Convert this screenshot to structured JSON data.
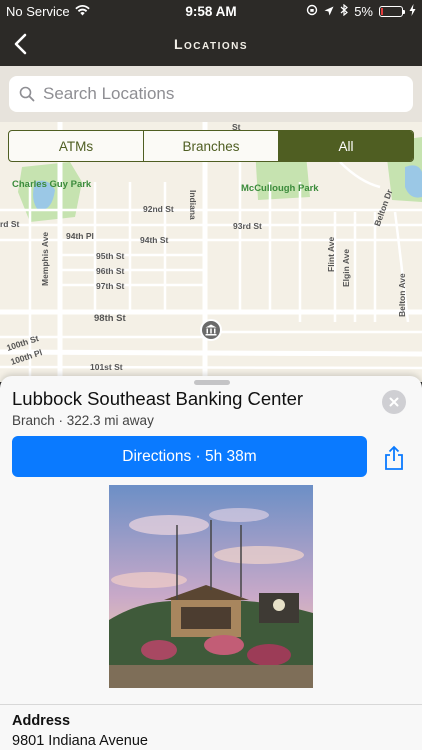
{
  "status_bar": {
    "carrier": "No Service",
    "time": "9:58 AM",
    "battery_percent": "5%"
  },
  "nav": {
    "title": "Locations"
  },
  "search": {
    "placeholder": "Search Locations"
  },
  "filter": {
    "options": [
      "ATMs",
      "Branches",
      "All"
    ],
    "selected": "All"
  },
  "map": {
    "streets": [
      "92nd St",
      "93rd St",
      "94th Pl",
      "94th St",
      "95th St",
      "96th St",
      "97th St",
      "98th St",
      "100th St",
      "100th Pl",
      "101st St",
      "Memphis Ave",
      "Indiana",
      "Flint Ave",
      "Elgin Ave",
      "Belton Ave",
      "Belton Dr",
      "St",
      "rd St"
    ],
    "parks": [
      "Charles Guy Park",
      "McCullough Park"
    ]
  },
  "location": {
    "name": "Lubbock Southeast Banking Center",
    "subtitle": "Branch · 322.3 mi away",
    "directions_label": "Directions · 5h 38m",
    "address_label": "Address",
    "address_value": "9801 Indiana Avenue"
  },
  "colors": {
    "brand": "#4f5e22",
    "accent": "#0a7aff",
    "header_bg": "#2c2a27"
  }
}
